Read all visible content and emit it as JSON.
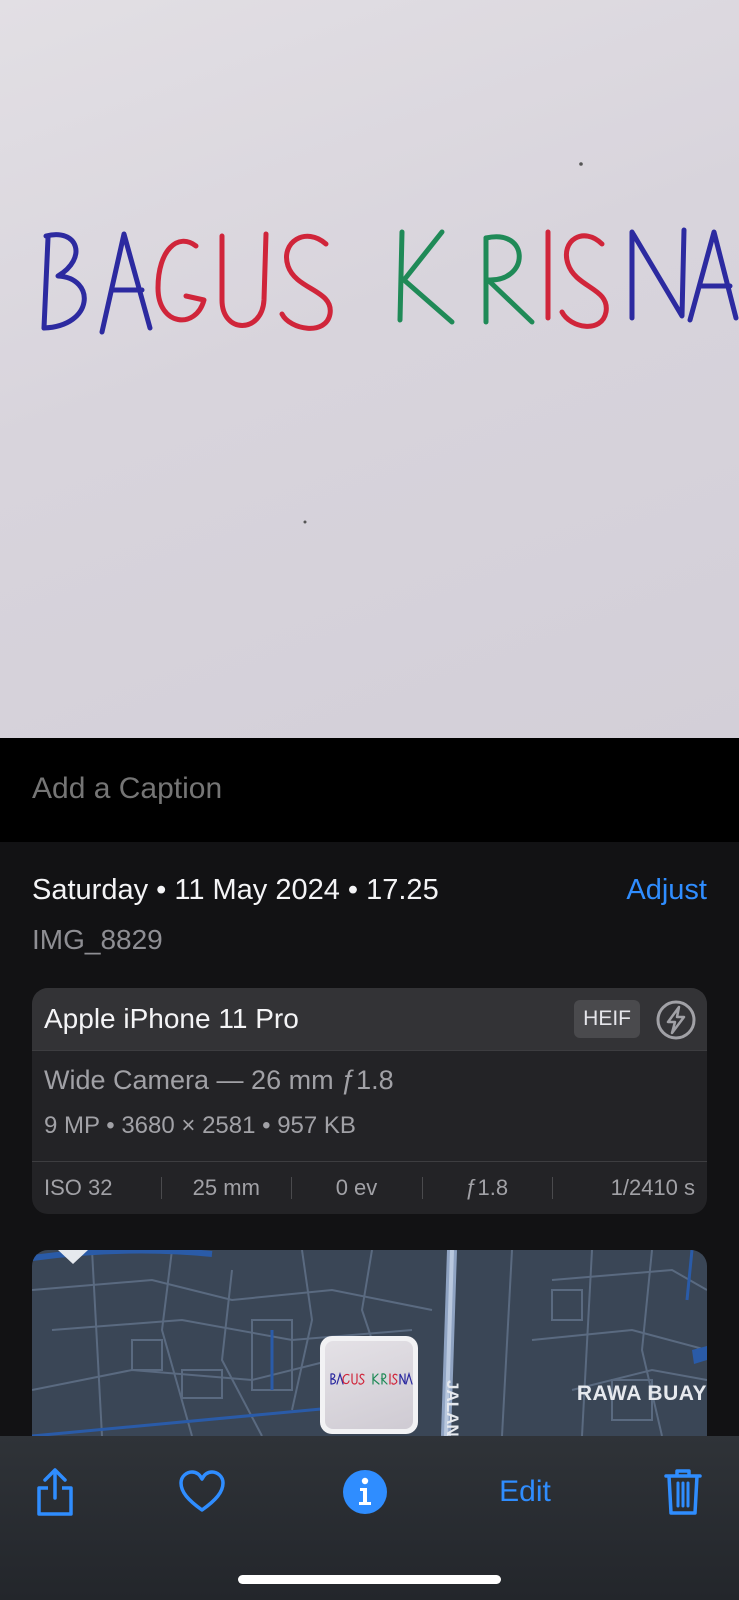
{
  "photo": {
    "handwritten_text": [
      "BAGUS",
      "KRISNA"
    ]
  },
  "caption": {
    "placeholder": "Add a Caption"
  },
  "info": {
    "date": "Saturday • 11 May 2024 • 17.25",
    "adjust_label": "Adjust",
    "filename": "IMG_8829",
    "camera": {
      "model": "Apple iPhone 11 Pro",
      "format_badge": "HEIF",
      "flash_icon": "flash-off-icon",
      "lens": "Wide Camera — 26 mm ƒ1.8",
      "specs": "9 MP  •  3680 × 2581  •  957 KB",
      "exif": [
        "ISO 32",
        "25 mm",
        "0 ev",
        "ƒ1.8",
        "1/2410 s"
      ]
    },
    "map": {
      "place_label": "RAWA BUAY",
      "road_label": "JALAN"
    }
  },
  "toolbar": {
    "share_icon": "share-icon",
    "favorite_icon": "heart-icon",
    "info_icon": "info-icon",
    "edit_label": "Edit",
    "delete_icon": "trash-icon"
  },
  "colors": {
    "accent": "#2f8dff",
    "ink_blue": "#2c2aa0",
    "ink_red": "#d0253a",
    "ink_green": "#1f8a57"
  }
}
